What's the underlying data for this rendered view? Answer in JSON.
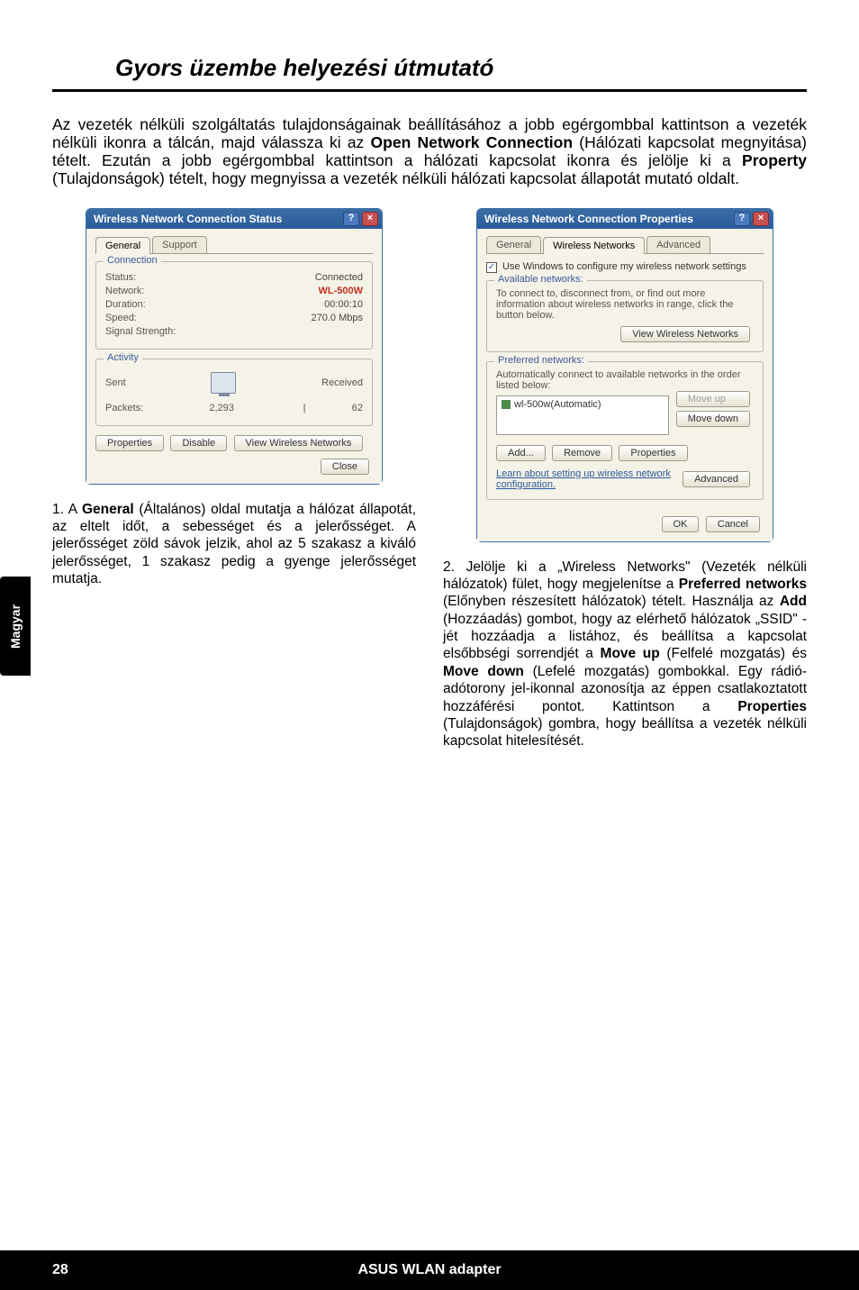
{
  "sideTab": "Magyar",
  "pageTitle": "Gyors üzembe helyezési útmutató",
  "intro": {
    "pre": "Az vezeték nélküli szolgáltatás tulajdonságainak beállításához a jobb egérgombbal kattintson a vezeték nélküli ikonra a tálcán, majd válassza ki az ",
    "b1": "Open Network Connection",
    "mid1": " (Hálózati kapcsolat megnyitása) tételt. Ezután a jobb egérgombbal kattintson a hálózati kapcsolat ikonra és jelölje ki a ",
    "b2": "Property",
    "post": " (Tulajdonságok) tételt, hogy megnyissa a vezeték nélküli hálózati kapcsolat állapotát mutató oldalt."
  },
  "dlg1": {
    "title": "Wireless Network Connection Status",
    "tab_general": "General",
    "tab_support": "Support",
    "grp_connection": "Connection",
    "status_k": "Status:",
    "status_v": "Connected",
    "network_k": "Network:",
    "network_v": "WL-500W",
    "duration_k": "Duration:",
    "duration_v": "00:00:10",
    "speed_k": "Speed:",
    "speed_v": "270.0 Mbps",
    "signal_k": "Signal Strength:",
    "grp_activity": "Activity",
    "sent": "Sent",
    "received": "Received",
    "packets_k": "Packets:",
    "packets_sent": "2,293",
    "packets_recv": "62",
    "btn_properties": "Properties",
    "btn_disable": "Disable",
    "btn_view": "View Wireless Networks",
    "btn_close": "Close"
  },
  "dlg2": {
    "title": "Wireless Network Connection Properties",
    "tab_general": "General",
    "tab_wireless": "Wireless Networks",
    "tab_advanced": "Advanced",
    "chk_label": "Use Windows to configure my wireless network settings",
    "grp_available": "Available networks:",
    "avail_desc": "To connect to, disconnect from, or find out more information about wireless networks in range, click the button below.",
    "btn_view": "View Wireless Networks",
    "grp_preferred": "Preferred networks:",
    "pref_desc": "Automatically connect to available networks in the order listed below:",
    "pref_item": "wl-500w(Automatic)",
    "btn_moveup": "Move up",
    "btn_movedown": "Move down",
    "btn_add": "Add...",
    "btn_remove": "Remove",
    "btn_properties": "Properties",
    "learn_link": "Learn about setting up wireless network configuration.",
    "btn_advanced": "Advanced",
    "btn_ok": "OK",
    "btn_cancel": "Cancel"
  },
  "caption1": {
    "num": "1. ",
    "pre": "A ",
    "b1": "General",
    "post": " (Általános) oldal mutatja a hálózat állapotát, az eltelt időt, a sebességet és a jelerősséget. A jelerősséget zöld sávok jelzik, ahol az 5 szakasz a kiváló jelerősséget, 1 szakasz pedig a gyenge jelerősséget mutatja."
  },
  "caption2": {
    "num": "2. ",
    "t1": "Jelölje ki a „Wireless Networks\" (Vezeték nélküli hálózatok) fület, hogy megjelenítse a ",
    "b1": "Preferred networks",
    "t2": " (Előnyben részesített hálózatok) tételt. Használja az ",
    "b2": "Add",
    "t3": " (Hozzáadás) gombot, hogy az elérhető hálózatok „SSID\" -jét hozzáadja a listához, és beállítsa a kapcsolat elsőbbségi sorrendjét a ",
    "b3": "Move up",
    "t4": " (Felfelé mozgatás) és ",
    "b4": "Move down",
    "t5": " (Lefelé mozgatás) gombokkal. Egy rádió-adótorony jel-ikonnal azonosítja az éppen csatlakoztatott hozzáférési pontot. Kattintson a ",
    "b5": "Properties",
    "t6": " (Tulajdonságok) gombra, hogy beállítsa a vezeték nélküli kapcsolat hitelesítését."
  },
  "footer": {
    "pageNum": "28",
    "product": "ASUS WLAN adapter"
  }
}
